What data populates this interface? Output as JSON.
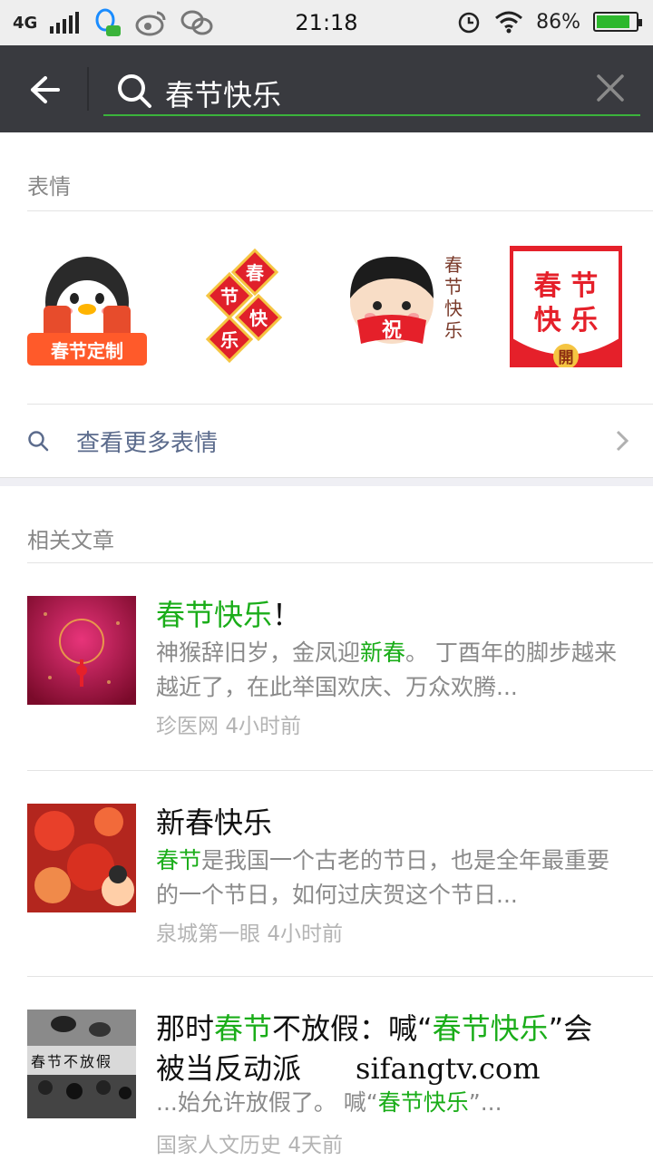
{
  "status_bar": {
    "network": "4G",
    "time": "21:18",
    "battery": "86%",
    "battery_level": 0.86,
    "icons": [
      "qq-icon",
      "weibo-icon",
      "wechat-icon",
      "alarm-icon",
      "wifi-icon"
    ]
  },
  "search": {
    "query": "春节快乐"
  },
  "stickers_section": {
    "title": "表情",
    "sticker1_badge": "春节定制",
    "sticker2_chars": [
      "春",
      "节",
      "快",
      "乐"
    ],
    "sticker3_chars": [
      "春",
      "节",
      "快",
      "乐"
    ],
    "sticker3_badge": "祝",
    "sticker4_lines": [
      "春 节",
      "快 乐"
    ],
    "sticker4_badge": "開",
    "more_label": "查看更多表情"
  },
  "articles_section": {
    "title": "相关文章",
    "items": [
      {
        "title_highlight": "春节快乐",
        "title_rest": "！",
        "desc_prefix": "神猴辞旧岁，金凤迎",
        "desc_highlight": "新春",
        "desc_rest": "。 丁酉年的脚步越来越近了，在此举国欢庆、万众欢腾...",
        "source": "珍医网",
        "time": "4小时前"
      },
      {
        "title_highlight": "新春快乐",
        "desc_highlight": "春节",
        "desc_rest": "是我国一个古老的节日，也是全年最重要的一个节日，如何过庆贺这个节日...",
        "source": "泉城第一眼",
        "time": "4小时前"
      },
      {
        "title_p1": "那时",
        "title_h1": "春节",
        "title_p2": "不放假：喊“",
        "title_h2": "春节快乐",
        "title_p3": "”会",
        "title_line2": "被当反动派",
        "watermark": "sifangtv.com",
        "desc_prefix": "...始允许放假了。 喊“",
        "desc_highlight": "春节快乐",
        "desc_rest": "”...",
        "thumb_text": "春节不放假",
        "source": "国家人文历史",
        "time": "4天前"
      }
    ]
  },
  "colors": {
    "accent_green": "#1aad19",
    "header_bg": "#393a3f",
    "link_blue": "#5b6b8c"
  }
}
